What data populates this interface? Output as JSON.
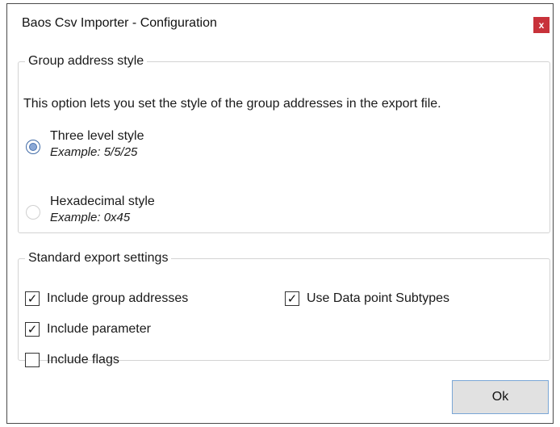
{
  "window": {
    "title": "Baos Csv Importer - Configuration",
    "close_label": "x"
  },
  "group_address": {
    "legend": "Group address style",
    "description": "This option lets you set the style of the group addresses in the export file.",
    "options": [
      {
        "label": "Three level style",
        "example": "Example: 5/5/25",
        "selected": true
      },
      {
        "label": "Hexadecimal style",
        "example": "Example: 0x45",
        "selected": false
      }
    ]
  },
  "export_settings": {
    "legend": "Standard export settings",
    "checkboxes": [
      {
        "label": "Include group addresses",
        "checked": true
      },
      {
        "label": "Include parameter",
        "checked": true
      },
      {
        "label": "Include flags",
        "checked": false
      },
      {
        "label": "Use Data point Subtypes",
        "checked": true
      }
    ]
  },
  "buttons": {
    "ok_label": "Ok"
  },
  "colors": {
    "close_button": "#c8323a",
    "radio_selected": "#8aa8d6",
    "ok_border": "#7aa6d6"
  }
}
